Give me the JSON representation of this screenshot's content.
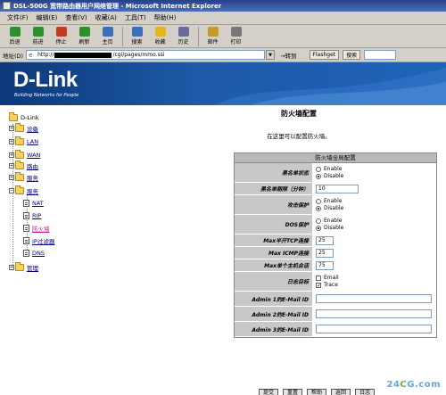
{
  "window": {
    "title": "DSL-500G 宽带路由器用户网络管理 - Microsoft Internet Explorer"
  },
  "menu": [
    {
      "label": "文件(F)"
    },
    {
      "label": "编辑(E)"
    },
    {
      "label": "查看(V)"
    },
    {
      "label": "收藏(A)"
    },
    {
      "label": "工具(T)"
    },
    {
      "label": "帮助(H)"
    }
  ],
  "toolbar": [
    {
      "label": "后退",
      "icon": "back-icon",
      "color": "#2f8f2f"
    },
    {
      "label": "前进",
      "icon": "forward-icon",
      "color": "#2f8f2f"
    },
    {
      "label": "停止",
      "icon": "stop-icon",
      "color": "#c23b22"
    },
    {
      "label": "刷新",
      "icon": "refresh-icon",
      "color": "#2f8f2f"
    },
    {
      "label": "主页",
      "icon": "home-icon",
      "color": "#3b6fb6"
    },
    {
      "label": "搜索",
      "icon": "search-icon",
      "color": "#3b6fb6"
    },
    {
      "label": "收藏",
      "icon": "favorites-icon",
      "color": "#e6b422"
    },
    {
      "label": "历史",
      "icon": "history-icon",
      "color": "#6b6b9b"
    },
    {
      "label": "邮件",
      "icon": "mail-icon",
      "color": "#c49a2b"
    },
    {
      "label": "打印",
      "icon": "print-icon",
      "color": "#777777"
    }
  ],
  "address": {
    "label": "地址(D)",
    "url_prefix": "http://",
    "url_suffix": "/cgi/pages/mmo.ssi",
    "go": "→转到",
    "links": [
      "Flashget",
      "搜索"
    ]
  },
  "banner": {
    "logo": "D-Link",
    "tagline": "Building Networks for People"
  },
  "tree": [
    {
      "label": "D-Link",
      "type": "root",
      "indent": 0
    },
    {
      "label": "设备",
      "type": "folder",
      "indent": 1
    },
    {
      "label": "LAN",
      "type": "folder",
      "indent": 1
    },
    {
      "label": "WAN",
      "type": "folder",
      "indent": 1
    },
    {
      "label": "路由",
      "type": "folder",
      "indent": 1
    },
    {
      "label": "服务",
      "type": "folder",
      "indent": 1
    },
    {
      "label": "服务",
      "type": "folder-open",
      "indent": 1
    },
    {
      "label": "NAT",
      "type": "page",
      "indent": 2
    },
    {
      "label": "RIP",
      "type": "page",
      "indent": 2
    },
    {
      "label": "防火墙",
      "type": "page",
      "indent": 2,
      "active": true
    },
    {
      "label": "IP过滤器",
      "type": "page",
      "indent": 2
    },
    {
      "label": "DNS",
      "type": "page",
      "indent": 2
    },
    {
      "label": "管理",
      "type": "folder",
      "indent": 1
    }
  ],
  "main": {
    "title": "防火墙配置",
    "description": "在这里可以配置防火墙。",
    "table_header": "防火墙全局配置",
    "rows": [
      {
        "label": "黑名单状态",
        "type": "radio",
        "options": [
          "Enable",
          "Disable"
        ],
        "selected": 1
      },
      {
        "label": "黑名单期限（分钟）",
        "type": "text",
        "value": "10"
      },
      {
        "label": "攻击保护",
        "type": "radio",
        "options": [
          "Enable",
          "Disable"
        ],
        "selected": 1
      },
      {
        "label": "DOS保护",
        "type": "radio",
        "options": [
          "Enable",
          "Disable"
        ],
        "selected": 1
      },
      {
        "label": "Max半开TCP连接",
        "type": "text",
        "value": "25"
      },
      {
        "label": "Max ICMP连接",
        "type": "text",
        "value": "25"
      },
      {
        "label": "Max单个主机会话",
        "type": "text",
        "value": "75"
      },
      {
        "label": "日志目标",
        "type": "checkbox",
        "options": [
          "Email",
          "Trace"
        ],
        "checked": [
          false,
          true
        ]
      },
      {
        "label": "Admin 1的E-Mail ID",
        "type": "text",
        "value": ""
      },
      {
        "label": "Admin 2的E-Mail ID",
        "type": "text",
        "value": ""
      },
      {
        "label": "Admin 3的E-Mail ID",
        "type": "text",
        "value": ""
      }
    ],
    "buttons": [
      "提交",
      "重置",
      "帮助",
      "返回",
      "日志"
    ]
  },
  "watermark": {
    "prefix": "24",
    "accent": "C",
    "suffix": "G.com"
  }
}
